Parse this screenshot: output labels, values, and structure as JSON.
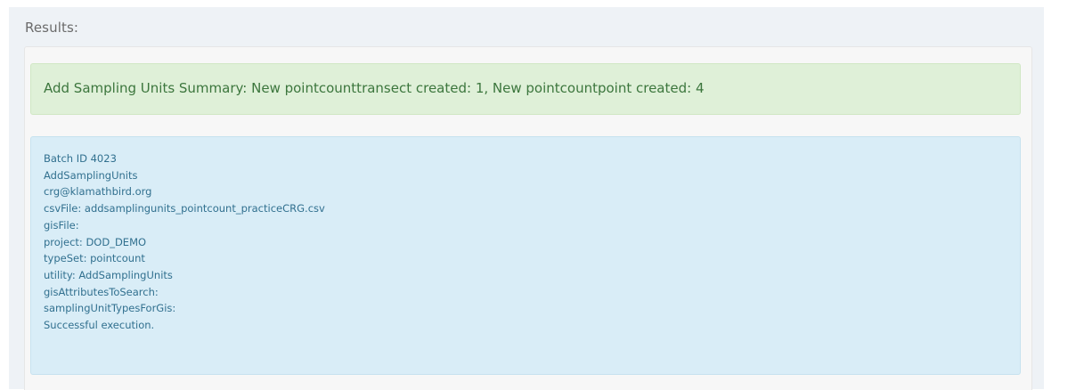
{
  "results": {
    "label": "Results:",
    "summary": "Add Sampling Units Summary: New pointcounttransect created: 1, New pointcountpoint created: 4",
    "log": [
      "Batch ID 4023",
      "AddSamplingUnits",
      "crg@klamathbird.org",
      "csvFile: addsamplingunits_pointcount_practiceCRG.csv",
      "gisFile:",
      "project: DOD_DEMO",
      "typeSet: pointcount",
      "utility: AddSamplingUnits",
      "gisAttributesToSearch:",
      "samplingUnitTypesForGis:",
      "Successful execution."
    ]
  },
  "colors": {
    "success_bg": "#dff0d8",
    "success_text": "#3c763d",
    "info_bg": "#d9edf7",
    "info_text": "#31708f"
  }
}
